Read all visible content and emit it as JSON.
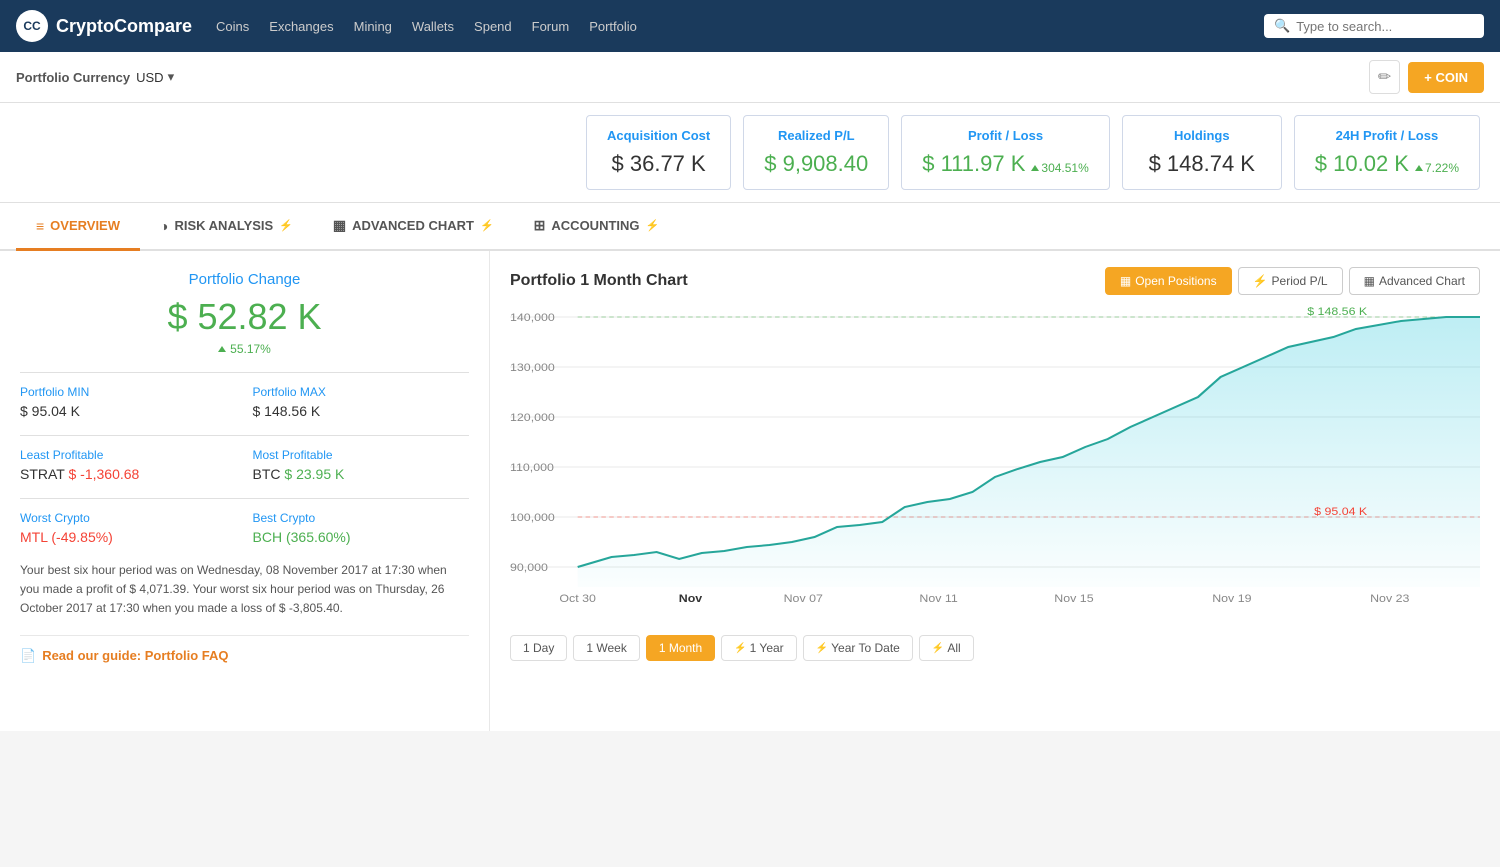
{
  "nav": {
    "logo_text_blue": "Crypto",
    "logo_text_white": "Compare",
    "logo_abbr": "CC",
    "links": [
      "Coins",
      "Exchanges",
      "Mining",
      "Wallets",
      "Spend",
      "Forum",
      "Portfolio"
    ],
    "search_placeholder": "Type to search..."
  },
  "subheader": {
    "portfolio_currency_label": "Portfolio Currency",
    "portfolio_currency_value": "USD",
    "add_coin_label": "+ COIN"
  },
  "metrics": [
    {
      "id": "acquisition-cost",
      "label": "Acquisition Cost",
      "value": "$ 36.77 K",
      "badge": null
    },
    {
      "id": "realized-pl",
      "label": "Realized P/L",
      "value": "$ 9,908.40",
      "badge": null,
      "value_color": "green"
    },
    {
      "id": "profit-loss",
      "label": "Profit / Loss",
      "value": "$ 111.97 K",
      "badge": "304.51%",
      "value_color": "green"
    },
    {
      "id": "holdings",
      "label": "Holdings",
      "value": "$ 148.74 K",
      "badge": null
    },
    {
      "id": "profit24h",
      "label": "24H Profit / Loss",
      "value": "$ 10.02 K",
      "badge": "7.22%",
      "value_color": "green"
    }
  ],
  "tabs": [
    {
      "id": "overview",
      "label": "OVERVIEW",
      "icon": "≡",
      "active": true,
      "lightning": false
    },
    {
      "id": "risk-analysis",
      "label": "RISK ANALYSIS",
      "icon": "◑",
      "active": false,
      "lightning": true
    },
    {
      "id": "advanced-chart",
      "label": "ADVANCED CHART",
      "icon": "▦",
      "active": false,
      "lightning": true
    },
    {
      "id": "accounting",
      "label": "ACCOUNTING",
      "icon": "⊞",
      "active": false,
      "lightning": true
    }
  ],
  "left_panel": {
    "portfolio_change_title": "Portfolio Change",
    "portfolio_change_value": "$ 52.82 K",
    "portfolio_change_badge": "55.17%",
    "stats": [
      {
        "label": "Portfolio MIN",
        "value": "$ 95.04 K",
        "color": "neutral"
      },
      {
        "label": "Portfolio MAX",
        "value": "$ 148.56 K",
        "color": "neutral"
      },
      {
        "label": "Least Profitable",
        "value": "STRAT $ -1,360.68",
        "color": "negative"
      },
      {
        "label": "Most Profitable",
        "value": "BTC $ 23.95 K",
        "color": "positive"
      },
      {
        "label": "Worst Crypto",
        "value": "MTL (-49.85%)",
        "color": "negative"
      },
      {
        "label": "Best Crypto",
        "value": "BCH (365.60%)",
        "color": "positive"
      }
    ],
    "description": "Your best six hour period was on Wednesday, 08 November 2017 at 17:30 when you made a profit of $ 4,071.39. Your worst six hour period was on Thursday, 26 October 2017 at 17:30 when you made a loss of $ -3,805.40.",
    "faq_label": "Read our guide: Portfolio FAQ"
  },
  "chart": {
    "title": "Portfolio 1 Month Chart",
    "buttons": [
      {
        "id": "open-positions",
        "label": "Open Positions",
        "icon": "▦",
        "active": true
      },
      {
        "id": "period-pl",
        "label": "Period P/L",
        "icon": "⚡",
        "active": false
      },
      {
        "id": "advanced-chart",
        "label": "Advanced Chart",
        "icon": "▦",
        "active": false
      }
    ],
    "max_label": "$ 148.56 K",
    "min_label": "$ 95.04 K",
    "y_labels": [
      "90,000",
      "100,000",
      "110,000",
      "120,000",
      "130,000",
      "140,000"
    ],
    "x_labels": [
      "Oct 30",
      "Nov",
      "Nov 07",
      "Nov 11",
      "Nov 15",
      "Nov 19",
      "Nov 23"
    ],
    "timeframes": [
      {
        "id": "1day",
        "label": "1 Day",
        "active": false,
        "lightning": false
      },
      {
        "id": "1week",
        "label": "1 Week",
        "active": false,
        "lightning": false
      },
      {
        "id": "1month",
        "label": "1 Month",
        "active": true,
        "lightning": false
      },
      {
        "id": "1year",
        "label": "1 Year",
        "active": false,
        "lightning": true
      },
      {
        "id": "ytd",
        "label": "Year To Date",
        "active": false,
        "lightning": true
      },
      {
        "id": "all",
        "label": "All",
        "active": false,
        "lightning": true
      }
    ]
  }
}
